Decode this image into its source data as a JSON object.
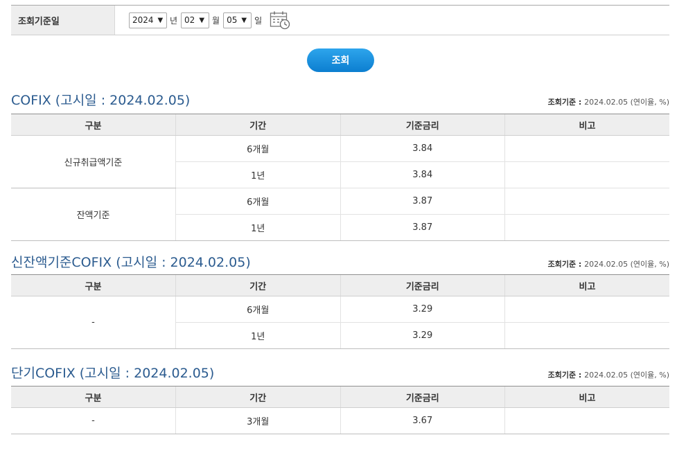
{
  "filter": {
    "label": "조회기준일",
    "year": "2024",
    "year_unit": "년",
    "month": "02",
    "month_unit": "월",
    "day": "05",
    "day_unit": "일"
  },
  "search_button": "조회",
  "headers": [
    "구분",
    "기간",
    "기준금리",
    "비고"
  ],
  "basis_prefix": "조회기준 : ",
  "basis_value": "2024.02.05 (연이율, %)",
  "sections": [
    {
      "title": "COFIX (고시일 : 2024.02.05)",
      "groups": [
        {
          "name": "신규취급액기준",
          "rows": [
            {
              "period": "6개월",
              "rate": "3.84",
              "note": ""
            },
            {
              "period": "1년",
              "rate": "3.84",
              "note": ""
            }
          ]
        },
        {
          "name": "잔액기준",
          "rows": [
            {
              "period": "6개월",
              "rate": "3.87",
              "note": ""
            },
            {
              "period": "1년",
              "rate": "3.87",
              "note": ""
            }
          ]
        }
      ]
    },
    {
      "title": "신잔액기준COFIX (고시일 : 2024.02.05)",
      "groups": [
        {
          "name": "-",
          "rows": [
            {
              "period": "6개월",
              "rate": "3.29",
              "note": ""
            },
            {
              "period": "1년",
              "rate": "3.29",
              "note": ""
            }
          ]
        }
      ]
    },
    {
      "title": "단기COFIX (고시일 : 2024.02.05)",
      "groups": [
        {
          "name": "-",
          "rows": [
            {
              "period": "3개월",
              "rate": "3.67",
              "note": ""
            }
          ]
        }
      ]
    }
  ]
}
